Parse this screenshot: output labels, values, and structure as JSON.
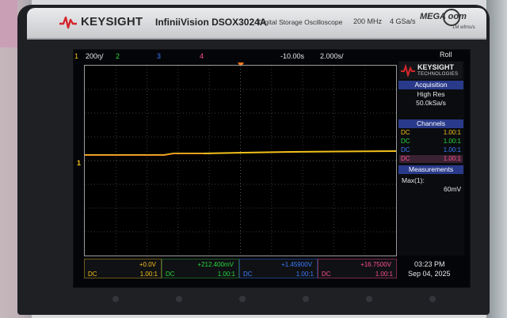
{
  "instrument": {
    "brand": "KEYSIGHT",
    "model": "InfiniiVision DSOX3024A",
    "subtitle": "Digital Storage Oscilloscope",
    "bandwidth": "200 MHz",
    "sample_rate": "4 GSa/s",
    "megazoom_text": "MEGA  oom",
    "megazoom_sub": "1M wfms/s"
  },
  "status_bar": {
    "ch1_num": "1",
    "ch1_scale": "200ŋ/",
    "ch2_num": "2",
    "ch3_num": "3",
    "ch4_num": "4",
    "time_offset": "-10.00s",
    "time_scale": "2.000s/",
    "mode": "Roll"
  },
  "side_panel": {
    "logo_name": "KEYSIGHT",
    "logo_sub": "TECHNOLOGIES",
    "acquisition_header": "Acquisition",
    "acquisition_mode": "High Res",
    "acquisition_rate": "50.0kSa/s",
    "channels_header": "Channels",
    "channels": [
      {
        "coupling": "DC",
        "ratio": "1.00:1"
      },
      {
        "coupling": "DC",
        "ratio": "1.00:1"
      },
      {
        "coupling": "DC",
        "ratio": "1.00:1"
      },
      {
        "coupling": "DC",
        "ratio": "1.00:1"
      }
    ],
    "measurements_header": "Measurements",
    "measurement_name": "Max(1):",
    "measurement_value": "60mV"
  },
  "channel_boxes": [
    {
      "scale": "+0.0V",
      "coupling": "DC",
      "probe": "1.00:1"
    },
    {
      "scale": "+212.400mV",
      "coupling": "DC",
      "probe": "1.00:1"
    },
    {
      "scale": "+1.45900V",
      "coupling": "DC",
      "probe": "1.00:1"
    },
    {
      "scale": "+16.7500V",
      "coupling": "DC",
      "probe": "1.00:1"
    }
  ],
  "clock": {
    "time": "03:23 PM",
    "date": "Sep 04, 2025"
  },
  "colors": {
    "ch1": "#f3c11b",
    "ch2": "#26d93a",
    "ch3": "#3a7cff",
    "ch4": "#ff4e8c",
    "panel_header": "#2a3a8a"
  }
}
